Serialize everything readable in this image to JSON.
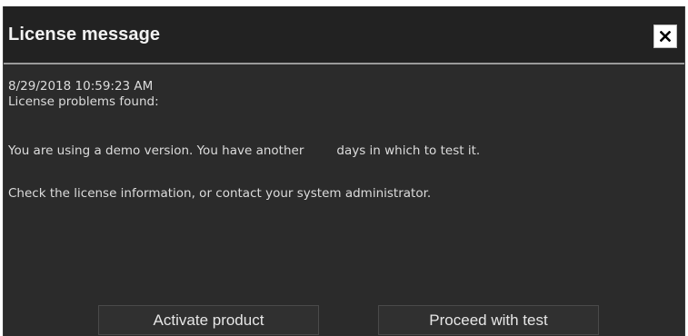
{
  "dialog": {
    "title": "License message",
    "close_icon": "close-icon"
  },
  "message": {
    "timestamp": "8/29/2018 10:59:23 AM",
    "problems_heading": "License problems found:",
    "demo_text_before": "You are using a demo version. You have another",
    "demo_days": "",
    "demo_text_after": "days in which to test it.",
    "check_text": "Check the license information, or contact your system administrator."
  },
  "buttons": {
    "activate_label": "Activate product",
    "proceed_label": "Proceed with test"
  },
  "colors": {
    "dialog_background": "#2b2b2b",
    "titlebar_background": "#222222",
    "text": "#dcdcdc",
    "button_background": "#303030"
  }
}
